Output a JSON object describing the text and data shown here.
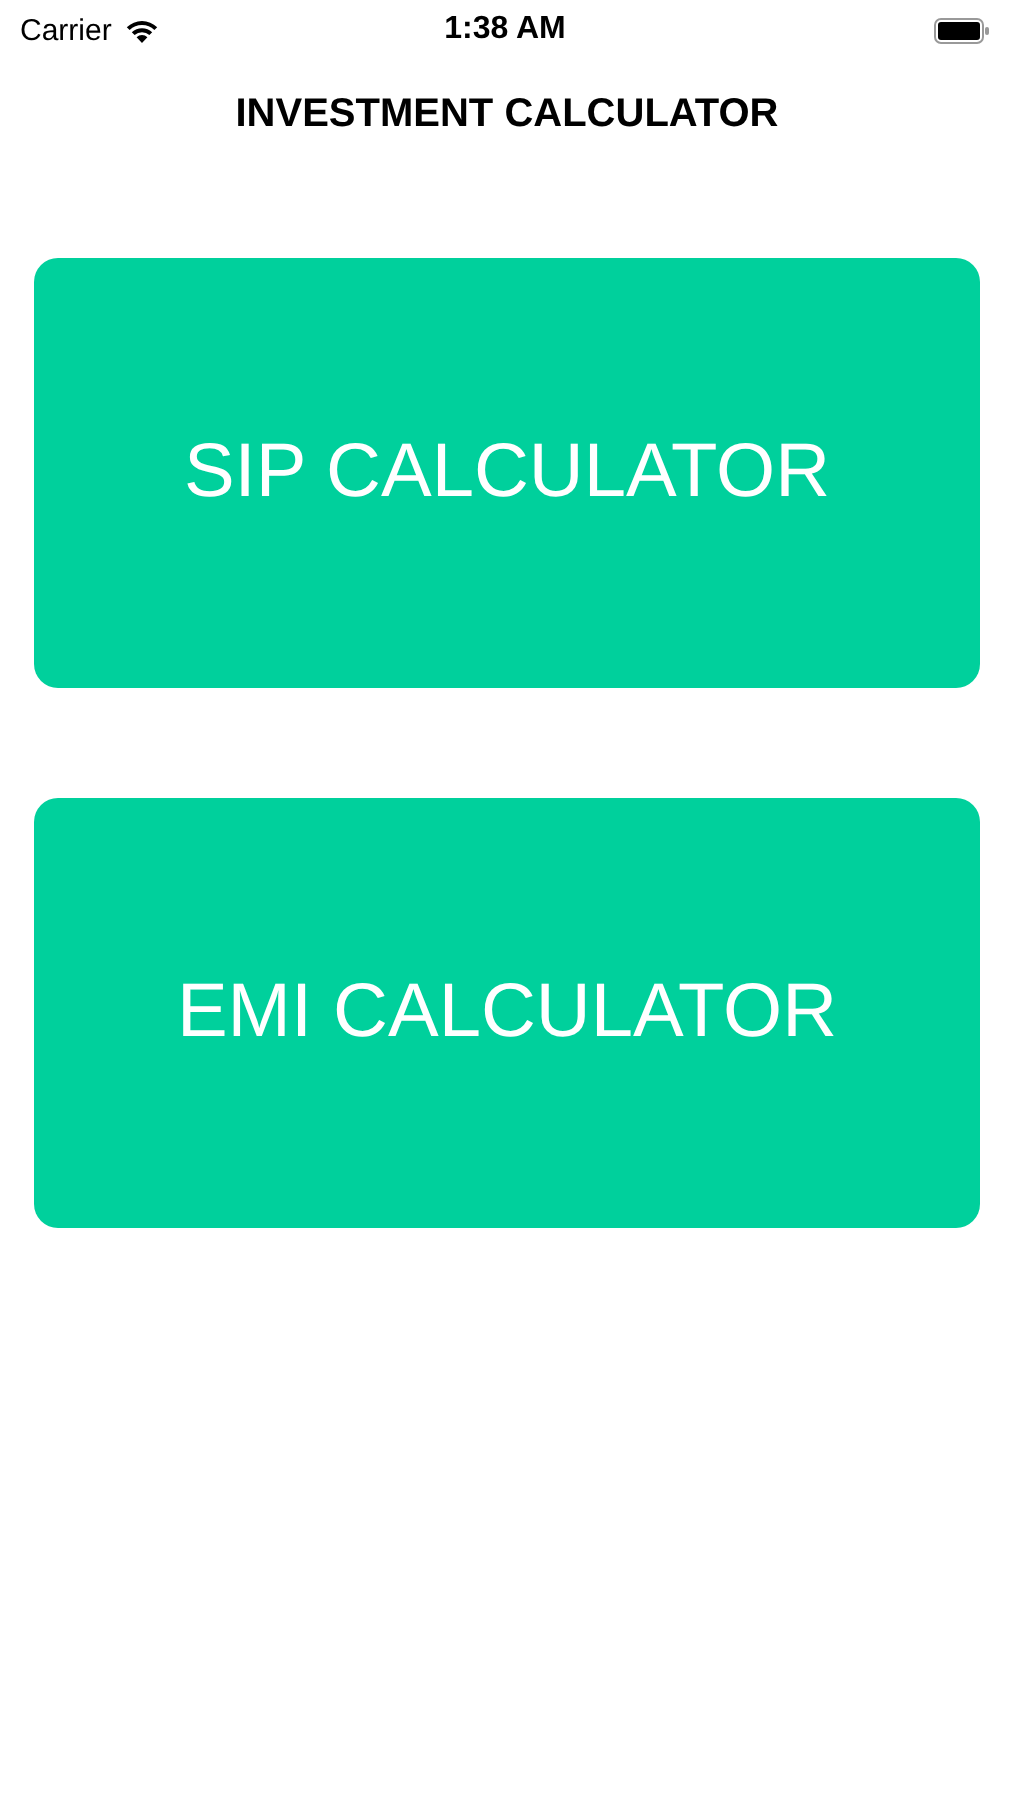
{
  "status_bar": {
    "carrier": "Carrier",
    "time": "1:38 AM"
  },
  "header": {
    "title": "INVESTMENT CALCULATOR"
  },
  "buttons": [
    {
      "label": "SIP CALCULATOR"
    },
    {
      "label": "EMI CALCULATOR"
    }
  ]
}
